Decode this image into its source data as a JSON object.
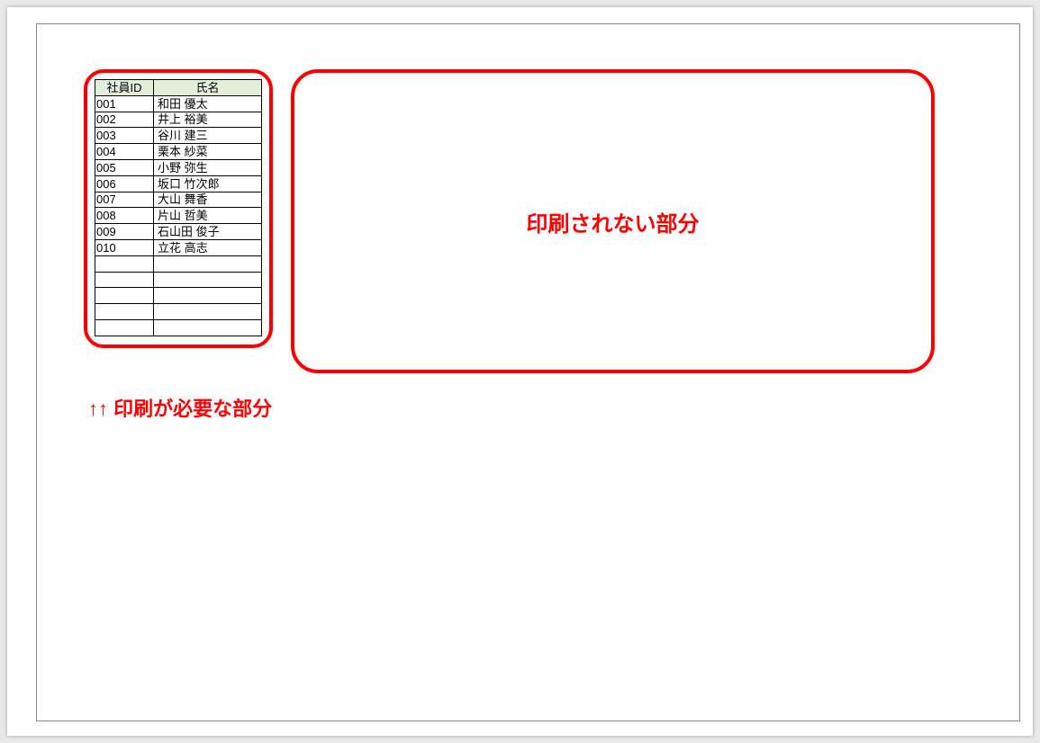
{
  "table": {
    "headers": {
      "id": "社員ID",
      "name": "氏名"
    },
    "rows": [
      {
        "id": "001",
        "name": "和田  優太"
      },
      {
        "id": "002",
        "name": "井上  裕美"
      },
      {
        "id": "003",
        "name": "谷川  建三"
      },
      {
        "id": "004",
        "name": "栗本  紗菜"
      },
      {
        "id": "005",
        "name": "小野  弥生"
      },
      {
        "id": "006",
        "name": "坂口  竹次郎"
      },
      {
        "id": "007",
        "name": "大山  舞香"
      },
      {
        "id": "008",
        "name": "片山  哲美"
      },
      {
        "id": "009",
        "name": "石山田  俊子"
      },
      {
        "id": "010",
        "name": "立花  高志"
      },
      {
        "id": "",
        "name": ""
      },
      {
        "id": "",
        "name": ""
      },
      {
        "id": "",
        "name": ""
      },
      {
        "id": "",
        "name": ""
      },
      {
        "id": "",
        "name": ""
      }
    ]
  },
  "annotations": {
    "not_printed": "印刷されない部分",
    "needed": "↑↑ 印刷が必要な部分"
  }
}
